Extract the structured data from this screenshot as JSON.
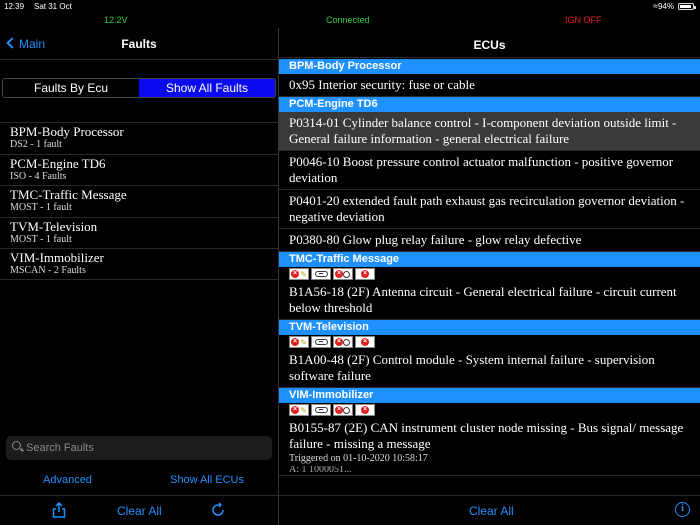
{
  "status_bar": {
    "time": "12:39",
    "date": "Sat 31 Oct",
    "battery": "94%",
    "battery_level": 0.94
  },
  "info_bar": {
    "voltage": "12.2V",
    "connection": "Connected",
    "ignition": "IGN OFF"
  },
  "left_nav": {
    "back_label": "Main",
    "title": "Faults"
  },
  "segments": [
    {
      "label": "Faults By Ecu",
      "active": false
    },
    {
      "label": "Show All Faults",
      "active": true
    }
  ],
  "ecus": [
    {
      "name": "BPM-Body Processor",
      "sub": "DS2 - 1 fault"
    },
    {
      "name": "PCM-Engine TD6",
      "sub": "ISO - 4 Faults"
    },
    {
      "name": "TMC-Traffic Message",
      "sub": "MOST - 1 fault"
    },
    {
      "name": "TVM-Television",
      "sub": "MOST - 1 fault"
    },
    {
      "name": "VIM-Immobilizer",
      "sub": "MSCAN - 2 Faults"
    }
  ],
  "search": {
    "placeholder": "Search Faults"
  },
  "left_links": {
    "advanced": "Advanced",
    "show_all_ecus": "Show All ECUs"
  },
  "left_toolbar": {
    "clear_all": "Clear All",
    "share_icon": "share-icon",
    "refresh_icon": "refresh-icon"
  },
  "right_nav": {
    "title": "ECUs"
  },
  "sections": {
    "bpm": {
      "header": "BPM-Body Processor",
      "faults": [
        "0x95 Interior security: fuse or cable"
      ]
    },
    "pcm": {
      "header": "PCM-Engine TD6",
      "faults": [
        "P0314-01 Cylinder balance control - I-component deviation outside limit - General failure information - general electrical failure",
        "P0046-10 Boost pressure control actuator malfunction - positive governor deviation",
        "P0401-20 extended fault path exhaust gas recirculation governor deviation - negative deviation",
        "P0380-80 Glow plug relay failure - glow relay defective"
      ]
    },
    "tmc": {
      "header": "TMC-Traffic Message",
      "faults": [
        "B1A56-18 (2F) Antenna circuit - General electrical failure - circuit current below threshold"
      ]
    },
    "tvm": {
      "header": "TVM-Television",
      "faults": [
        "B1A00-48 (2F) Control module - System internal failure - supervision software failure"
      ]
    },
    "vim": {
      "header": "VIM-Immobilizer",
      "faults": [
        "B0155-87 (2E) CAN instrument cluster node missing - Bus signal/ message failure - missing a message"
      ],
      "triggered": "Triggered on 01-10-2020 10:58:17",
      "cut_line": "A: 1 1000051..."
    }
  },
  "fault_icons": [
    "clear-fault-icon",
    "link-icon",
    "no-power-icon",
    "cancel-icon"
  ],
  "right_toolbar": {
    "clear_all": "Clear All",
    "info_icon": "info-icon"
  },
  "colors": {
    "accent": "#1e90ff",
    "segment_active": "#0a0aee",
    "ok": "#2ecc40",
    "alert": "#e02020"
  }
}
